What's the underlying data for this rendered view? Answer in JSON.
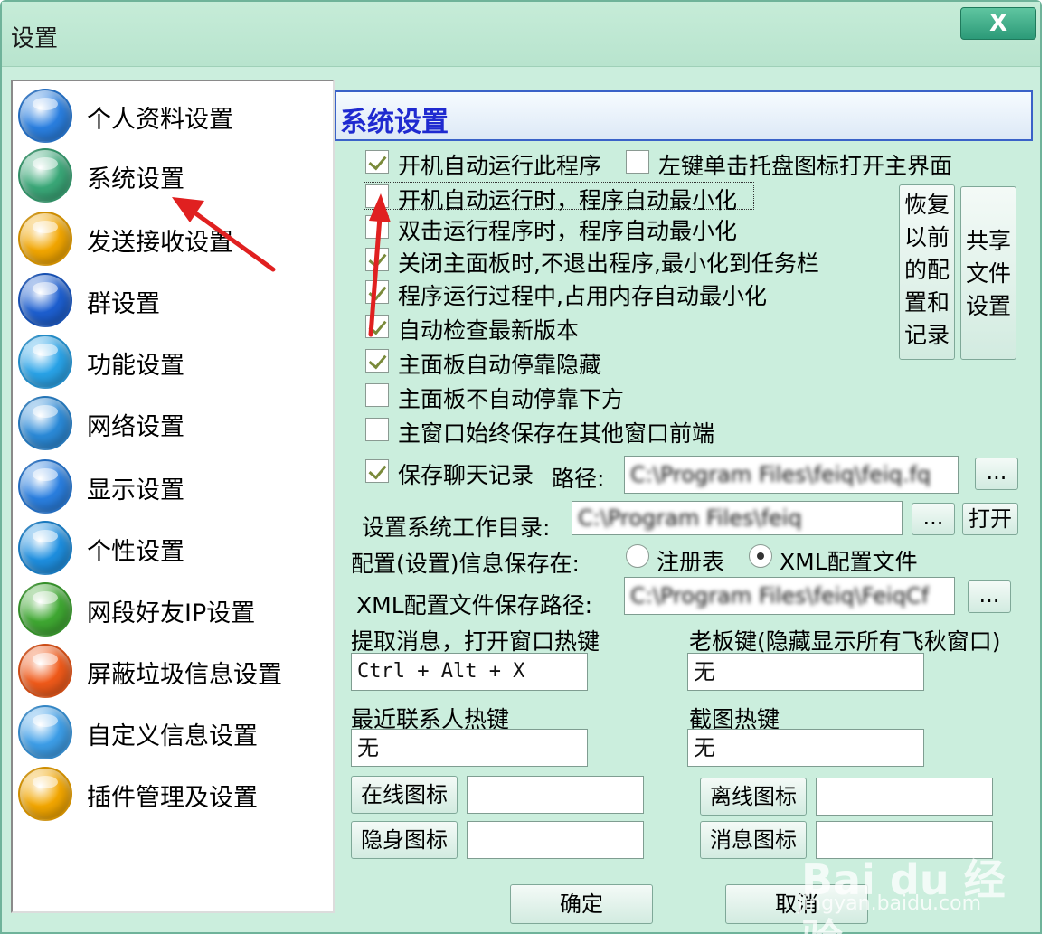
{
  "window": {
    "title": "设置",
    "close": "X"
  },
  "sidebar": {
    "items": [
      {
        "label": "个人资料设置",
        "icon": "blue-globe-icon",
        "color": "#2a7fe0"
      },
      {
        "label": "系统设置",
        "icon": "green-spinner-icon",
        "color": "#3aa878"
      },
      {
        "label": "发送接收设置",
        "icon": "yellow-orb-icon",
        "color": "#f2a600"
      },
      {
        "label": "群设置",
        "icon": "world-globe-icon",
        "color": "#1d5fd0"
      },
      {
        "label": "功能设置",
        "icon": "target-icon",
        "color": "#29a3e8"
      },
      {
        "label": "网络设置",
        "icon": "earth-icon",
        "color": "#2b8ad8"
      },
      {
        "label": "显示设置",
        "icon": "display-icon",
        "color": "#2a7fe0"
      },
      {
        "label": "个性设置",
        "icon": "flower-icon",
        "color": "#1e8fe0"
      },
      {
        "label": "网段好友IP设置",
        "icon": "green-snake-icon",
        "color": "#3fa832"
      },
      {
        "label": "屏蔽垃圾信息设置",
        "icon": "red-orb-icon",
        "color": "#f05a1a"
      },
      {
        "label": "自定义信息设置",
        "icon": "compass-icon",
        "color": "#3d9ee8"
      },
      {
        "label": "插件管理及设置",
        "icon": "yellow-orb-icon",
        "color": "#f2a600"
      }
    ]
  },
  "panel": {
    "title": "系统设置",
    "options": {
      "autorun": {
        "label": "开机自动运行此程序",
        "checked": true
      },
      "tray_click": {
        "label": "左键单击托盘图标打开主界面",
        "checked": false
      },
      "autorun_min": {
        "label": "开机自动运行时，程序自动最小化",
        "checked": false
      },
      "dblclick_min": {
        "label": "双击运行程序时，程序自动最小化",
        "checked": false
      },
      "close_to_tray": {
        "label": "关闭主面板时,不退出程序,最小化到任务栏",
        "checked": true
      },
      "mem_min": {
        "label": "程序运行过程中,占用内存自动最小化",
        "checked": true
      },
      "check_update": {
        "label": "自动检查最新版本",
        "checked": true
      },
      "auto_dock": {
        "label": "主面板自动停靠隐藏",
        "checked": true
      },
      "no_dock_bottom": {
        "label": "主面板不自动停靠下方",
        "checked": false
      },
      "always_top": {
        "label": "主窗口始终保存在其他窗口前端",
        "checked": false
      },
      "save_chat": {
        "label": "保存聊天记录",
        "checked": true
      }
    },
    "restore_button": "恢复以前的配置和记录",
    "share_button": "共享文件设置",
    "path_label": "路径:",
    "path_value": "C:\\Program Files\\feiq\\feiq.fq",
    "browse": "...",
    "workdir_label": "设置系统工作目录:",
    "workdir_value": "C:\\Program Files\\feiq",
    "open_button": "打开",
    "config_save_label": "配置(设置)信息保存在:",
    "radio_registry": "注册表",
    "radio_xml": "XML配置文件",
    "xml_path_label": "XML配置文件保存路径:",
    "xml_path_value": "C:\\Program Files\\feiq\\FeiqCf",
    "hotkey_msg_label": "提取消息，打开窗口热键",
    "hotkey_msg_value": "Ctrl + Alt + X",
    "boss_key_label": "老板键(隐藏显示所有飞秋窗口)",
    "boss_key_value": "无",
    "recent_label": "最近联系人热键",
    "recent_value": "无",
    "screenshot_label": "截图热键",
    "screenshot_value": "无",
    "online_icon": "在线图标",
    "offline_icon": "离线图标",
    "hidden_icon": "隐身图标",
    "message_icon": "消息图标",
    "ok": "确定",
    "cancel": "取消"
  },
  "watermark": {
    "main": "Bai du 经验",
    "sub": "jingyan.baidu.com"
  },
  "colors": {
    "window_bg": "#cbeedd",
    "title_text": "#1f2ad0",
    "arrow": "#e02020"
  }
}
